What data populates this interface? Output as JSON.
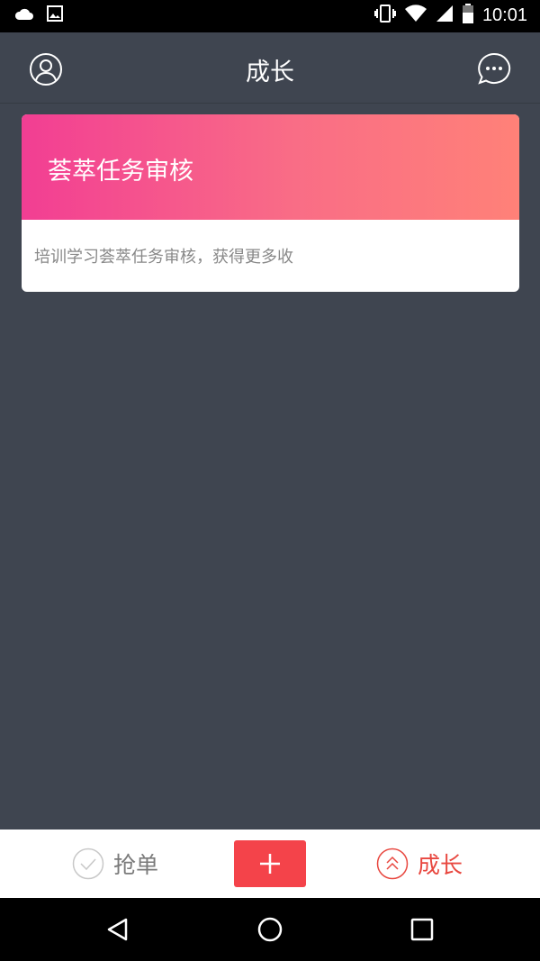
{
  "status_bar": {
    "time": "10:01"
  },
  "header": {
    "title": "成长"
  },
  "card": {
    "title": "荟萃任务审核",
    "description": "培训学习荟萃任务审核，获得更多收"
  },
  "bottom_nav": {
    "grab_label": "抢单",
    "grow_label": "成长",
    "active": "成长"
  },
  "colors": {
    "background": "#3f4550",
    "accent_red": "#f4434a",
    "active_tab": "#e8473f",
    "gradient_start": "#f23e93",
    "gradient_end": "#ff8178"
  },
  "icons": {
    "header_left": "user-icon",
    "header_right": "message-icon",
    "add": "plus-icon",
    "grab": "check-circle-icon",
    "grow": "double-chevron-up-icon"
  }
}
